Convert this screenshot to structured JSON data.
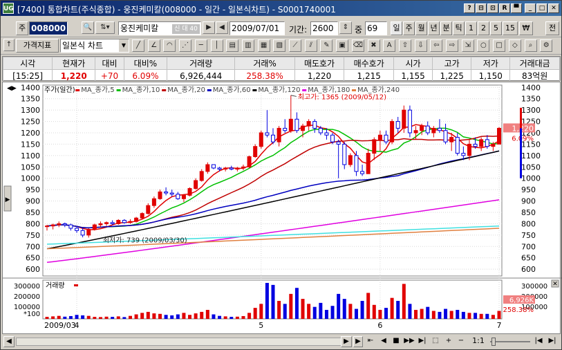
{
  "window": {
    "title": "[7400] 통합차트(주식종합) - 웅진케미칼(008000 - 일간 - 일본식차트) - S0001740001",
    "app_icon": "UG",
    "buttons": [
      "?",
      "⊟",
      "⊡",
      "R",
      "▀",
      "_",
      "□",
      "✕"
    ]
  },
  "toolbar1": {
    "code_label": "주",
    "code": "008000",
    "stock_name": "웅진케미칼",
    "badge": "신 대 40",
    "date": "2009/07/01",
    "period_label": "기간:",
    "period": "2600",
    "mid_label": "중",
    "mid_value": "69",
    "periods": [
      "일",
      "주",
      "월",
      "년",
      "분",
      "틱",
      "1",
      "2",
      "5",
      "15",
      "₩",
      "전"
    ]
  },
  "toolbar2": {
    "indicator_button": "가격지표",
    "chart_type": "일본식 차트",
    "tool_icons": [
      "line-icon",
      "angle-icon",
      "arc-icon",
      "fan-icon",
      "hline-icon",
      "vline-icon",
      "grid-icon",
      "grid2-icon",
      "grid3-icon",
      "grid4-icon",
      "diag-icon",
      "parallel-icon",
      "pencil-icon",
      "palette-icon",
      "eraser-icon",
      "delete-icon",
      "text-icon",
      "up-arrow-icon",
      "down-arrow-icon",
      "left-arrow-icon",
      "right-arrow-icon",
      "arrow-box-icon",
      "circle-icon",
      "square-icon",
      "diamond-icon",
      "zoom-icon",
      "settings-icon"
    ]
  },
  "quote": {
    "headers": [
      "시각",
      "현재가",
      "대비",
      "대비%",
      "거래량",
      "거래%",
      "매도호가",
      "매수호가",
      "시가",
      "고가",
      "저가",
      "거래대금"
    ],
    "values": [
      "[15:25]",
      "1,220",
      "+70",
      "6.09%",
      "6,926,444",
      "258.38%",
      "1,220",
      "1,215",
      "1,155",
      "1,225",
      "1,150",
      "83억원"
    ]
  },
  "chart_data": {
    "type": "candlestick",
    "legend": [
      "주가(일간)",
      "MA_종가,5",
      "MA_종가,10",
      "MA_종가,20",
      "MA_종가,60",
      "MA_종가,120",
      "MA_종가,180",
      "MA_종가,240"
    ],
    "legend_colors": [
      "#000000",
      "#e00000",
      "#00c000",
      "#c00000",
      "#0000c0",
      "#000000",
      "#e000e0",
      "#e08040",
      "#40e0e0"
    ],
    "y_ticks": [
      1400,
      1350,
      1300,
      1250,
      1200,
      1150,
      1100,
      1050,
      1000,
      950,
      900,
      850,
      800,
      750,
      700,
      650,
      600
    ],
    "ylim": [
      570,
      1410
    ],
    "x_labels": [
      "2009/03",
      "4",
      "5",
      "6",
      "7"
    ],
    "high_annotation": "최고가: 1365 (2009/05/12)",
    "low_annotation": "최저가: 739 (2009/03/30)",
    "last_price": "1,220",
    "last_pct": "6.09%",
    "volume_label": "거래량",
    "volume_ticks": [
      "300000",
      "200000",
      "100000"
    ],
    "volume_unit": "*100",
    "volume_last": "6,926K",
    "volume_pct": "258.38%",
    "volume_max": 360000,
    "candles": [
      [
        790,
        795,
        770,
        790
      ],
      [
        790,
        800,
        775,
        795
      ],
      [
        795,
        810,
        785,
        800
      ],
      [
        800,
        805,
        785,
        795
      ],
      [
        795,
        800,
        770,
        780
      ],
      [
        780,
        790,
        760,
        770
      ],
      [
        770,
        785,
        740,
        750
      ],
      [
        750,
        780,
        739,
        775
      ],
      [
        775,
        800,
        770,
        795
      ],
      [
        795,
        810,
        785,
        800
      ],
      [
        800,
        810,
        790,
        805
      ],
      [
        805,
        815,
        795,
        800
      ],
      [
        800,
        820,
        795,
        815
      ],
      [
        815,
        820,
        800,
        805
      ],
      [
        805,
        820,
        800,
        810
      ],
      [
        810,
        830,
        805,
        825
      ],
      [
        825,
        850,
        820,
        845
      ],
      [
        845,
        890,
        840,
        880
      ],
      [
        880,
        920,
        870,
        910
      ],
      [
        910,
        950,
        905,
        940
      ],
      [
        940,
        960,
        925,
        935
      ],
      [
        935,
        950,
        920,
        930
      ],
      [
        930,
        940,
        905,
        910
      ],
      [
        910,
        930,
        895,
        925
      ],
      [
        925,
        960,
        920,
        955
      ],
      [
        955,
        1000,
        950,
        990
      ],
      [
        990,
        1040,
        985,
        1030
      ],
      [
        1030,
        1070,
        1020,
        1060
      ],
      [
        1060,
        1060,
        1040,
        1045
      ],
      [
        1045,
        1050,
        1030,
        1040
      ],
      [
        1040,
        1050,
        1030,
        1045
      ],
      [
        1045,
        1055,
        1035,
        1040
      ],
      [
        1040,
        1050,
        1030,
        1045
      ],
      [
        1045,
        1060,
        1035,
        1050
      ],
      [
        1050,
        1100,
        1045,
        1095
      ],
      [
        1095,
        1150,
        1090,
        1140
      ],
      [
        1140,
        1210,
        1130,
        1200
      ],
      [
        1200,
        1300,
        1180,
        1190
      ],
      [
        1190,
        1220,
        1150,
        1160
      ],
      [
        1160,
        1230,
        1140,
        1220
      ],
      [
        1220,
        1260,
        1200,
        1210
      ],
      [
        1210,
        1365,
        1200,
        1260
      ],
      [
        1260,
        1290,
        1200,
        1210
      ],
      [
        1210,
        1240,
        1180,
        1230
      ],
      [
        1230,
        1260,
        1210,
        1250
      ],
      [
        1250,
        1260,
        1200,
        1220
      ],
      [
        1220,
        1230,
        1190,
        1200
      ],
      [
        1200,
        1220,
        1170,
        1190
      ],
      [
        1190,
        1200,
        1150,
        1160
      ],
      [
        1160,
        1170,
        1000,
        1150
      ],
      [
        1150,
        1160,
        1040,
        1060
      ],
      [
        1060,
        1110,
        1050,
        1100
      ],
      [
        1100,
        1120,
        1010,
        1030
      ],
      [
        1030,
        1060,
        1010,
        1020
      ],
      [
        1020,
        1130,
        1020,
        1110
      ],
      [
        1110,
        1180,
        1080,
        1170
      ],
      [
        1170,
        1210,
        1120,
        1190
      ],
      [
        1190,
        1210,
        1150,
        1160
      ],
      [
        1160,
        1260,
        1150,
        1250
      ],
      [
        1250,
        1270,
        1200,
        1220
      ],
      [
        1220,
        1320,
        1200,
        1300
      ],
      [
        1300,
        1320,
        1180,
        1200
      ],
      [
        1200,
        1230,
        1170,
        1210
      ],
      [
        1210,
        1240,
        1190,
        1230
      ],
      [
        1230,
        1250,
        1190,
        1200
      ],
      [
        1200,
        1230,
        1180,
        1220
      ],
      [
        1220,
        1260,
        1200,
        1210
      ],
      [
        1210,
        1240,
        1150,
        1160
      ],
      [
        1160,
        1200,
        1120,
        1180
      ],
      [
        1180,
        1200,
        1100,
        1110
      ],
      [
        1110,
        1140,
        1080,
        1100
      ],
      [
        1100,
        1170,
        1080,
        1150
      ],
      [
        1150,
        1180,
        1130,
        1140
      ],
      [
        1140,
        1180,
        1120,
        1170
      ],
      [
        1170,
        1190,
        1130,
        1140
      ],
      [
        1140,
        1160,
        1120,
        1150
      ],
      [
        1150,
        1225,
        1150,
        1220
      ]
    ],
    "volumes": [
      20000,
      25000,
      30000,
      22000,
      28000,
      40000,
      35000,
      30000,
      20000,
      18000,
      22000,
      20000,
      25000,
      18000,
      30000,
      45000,
      60000,
      70000,
      55000,
      50000,
      40000,
      35000,
      45000,
      60000,
      40000,
      55000,
      70000,
      90000,
      45000,
      30000,
      25000,
      20000,
      22000,
      28000,
      60000,
      110000,
      150000,
      360000,
      340000,
      180000,
      150000,
      250000,
      310000,
      200000,
      150000,
      120000,
      160000,
      90000,
      130000,
      250000,
      200000,
      150000,
      100000,
      180000,
      260000,
      140000,
      90000,
      110000,
      210000,
      180000,
      350000,
      150000,
      90000,
      100000,
      120000,
      80000,
      70000,
      100000,
      80000,
      90000,
      70000,
      60000,
      60000,
      50000,
      50000,
      40000,
      80000
    ]
  }
}
